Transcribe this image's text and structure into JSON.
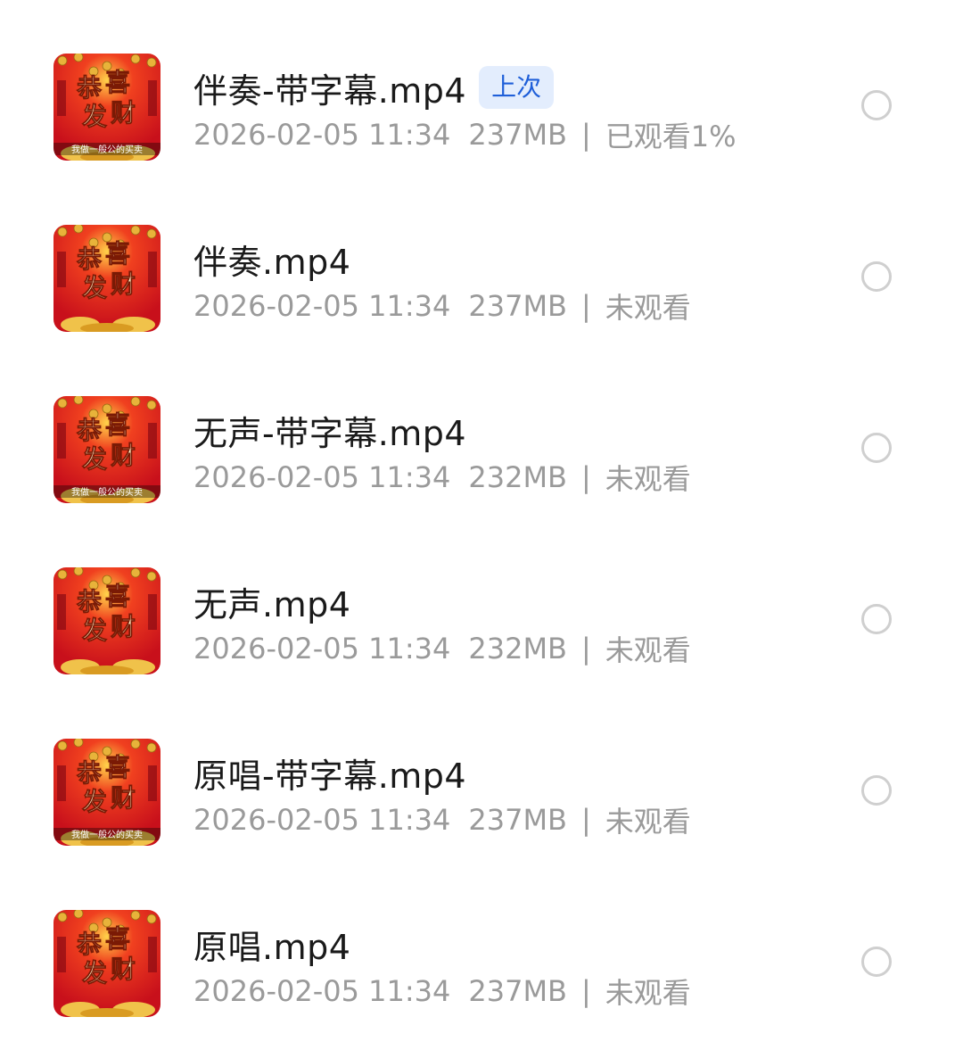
{
  "files": [
    {
      "name": "伴奏-带字幕.mp4",
      "badge": "上次",
      "date": "2026-02-05 11:34",
      "size": "237MB",
      "status": "已观看1%",
      "subtitle_strip": true
    },
    {
      "name": "伴奏.mp4",
      "badge": "",
      "date": "2026-02-05 11:34",
      "size": "237MB",
      "status": "未观看",
      "subtitle_strip": false
    },
    {
      "name": "无声-带字幕.mp4",
      "badge": "",
      "date": "2026-02-05 11:34",
      "size": "232MB",
      "status": "未观看",
      "subtitle_strip": true
    },
    {
      "name": "无声.mp4",
      "badge": "",
      "date": "2026-02-05 11:34",
      "size": "232MB",
      "status": "未观看",
      "subtitle_strip": false
    },
    {
      "name": "原唱-带字幕.mp4",
      "badge": "",
      "date": "2026-02-05 11:34",
      "size": "237MB",
      "status": "未观看",
      "subtitle_strip": true
    },
    {
      "name": "原唱.mp4",
      "badge": "",
      "date": "2026-02-05 11:34",
      "size": "237MB",
      "status": "未观看",
      "subtitle_strip": false
    }
  ],
  "meta_separator": "|",
  "thumbnail": {
    "text_main": "恭喜发财",
    "subtitle_text": "我做一般公的买卖"
  },
  "colors": {
    "thumb_red": "#c8101b",
    "thumb_gold": "#e8b33a",
    "badge_bg": "#e3edfd",
    "badge_text": "#1f5fd9",
    "meta_text": "#9a9a9a",
    "radio_border": "#cfcfcf"
  }
}
